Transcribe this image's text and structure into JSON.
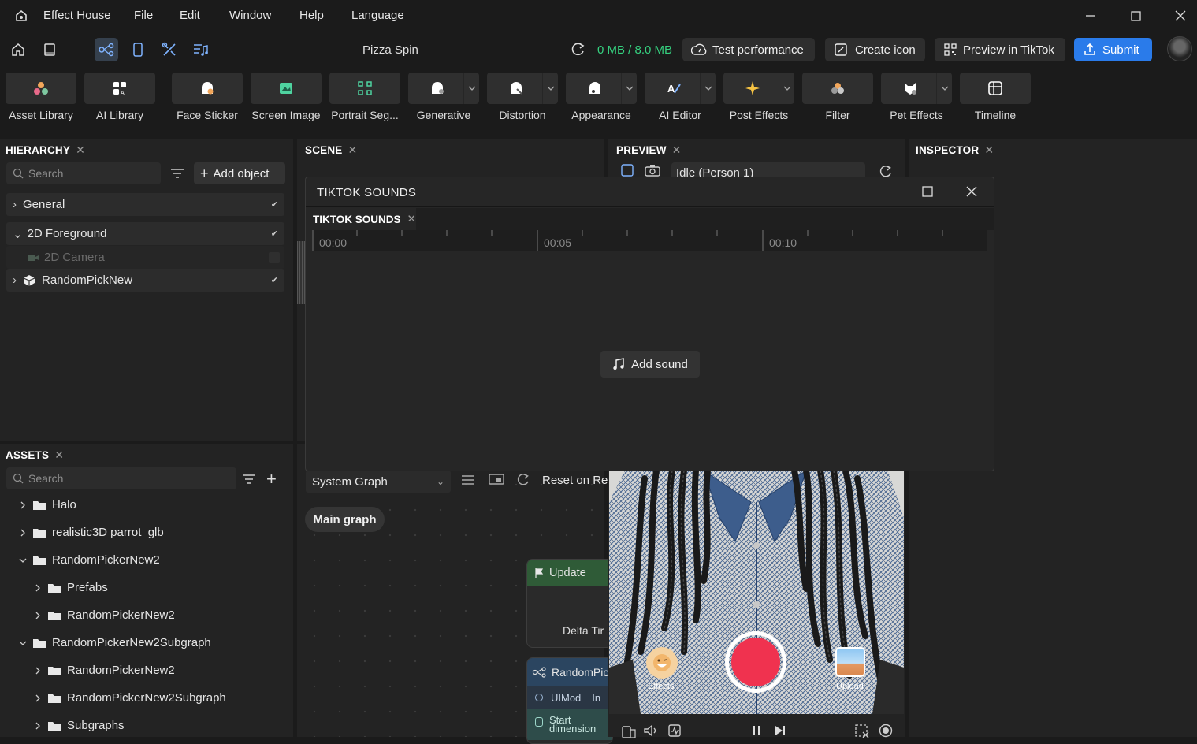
{
  "app": {
    "title": "Effect House",
    "menu": [
      "File",
      "Edit",
      "Window",
      "Help",
      "Language"
    ],
    "project_name": "Pizza Spin",
    "storage": "0 MB / 8.0 MB",
    "accent": "#2a7bea",
    "storage_color": "#35d07f"
  },
  "toolbar": {
    "test_performance": "Test performance",
    "create_icon": "Create icon",
    "preview_tiktok": "Preview in TikTok",
    "submit": "Submit"
  },
  "tools": [
    {
      "label": "Asset Library",
      "icon": "asset-library-icon"
    },
    {
      "label": "AI Library",
      "icon": "ai-library-icon"
    },
    {
      "label": "Face Sticker",
      "icon": "face-sticker-icon"
    },
    {
      "label": "Screen Image",
      "icon": "screen-image-icon"
    },
    {
      "label": "Portrait Seg...",
      "icon": "portrait-seg-icon"
    },
    {
      "label": "Generative",
      "icon": "generative-icon"
    },
    {
      "label": "Distortion",
      "icon": "distortion-icon"
    },
    {
      "label": "Appearance",
      "icon": "appearance-icon"
    },
    {
      "label": "AI Editor",
      "icon": "ai-editor-icon"
    },
    {
      "label": "Post Effects",
      "icon": "post-effects-icon"
    },
    {
      "label": "Filter",
      "icon": "filter-icon"
    },
    {
      "label": "Pet Effects",
      "icon": "pet-effects-icon"
    },
    {
      "label": "Timeline",
      "icon": "timeline-icon"
    }
  ],
  "hierarchy": {
    "tab": "HIERARCHY",
    "search_placeholder": "Search",
    "add_object": "Add object",
    "rows": [
      "General",
      "2D Foreground",
      "2D Camera",
      "RandomPickNew"
    ]
  },
  "assets": {
    "tab": "ASSETS",
    "search_placeholder": "Search",
    "items": [
      "Halo",
      "realistic3D parrot_glb",
      "RandomPickerNew2",
      "Prefabs",
      "RandomPickerNew2",
      "RandomPickerNew2Subgraph",
      "RandomPickerNew2",
      "RandomPickerNew2Subgraph",
      "Subgraphs"
    ]
  },
  "scene": {
    "tab": "SCENE"
  },
  "preview": {
    "tab": "PREVIEW",
    "person_select": "Idle (Person 1)",
    "effects": "Effects",
    "upload": "Upload"
  },
  "inspector": {
    "tab": "INSPECTOR"
  },
  "graph": {
    "system_graph": "System Graph",
    "reset": "Reset on Re",
    "main_graph": "Main graph",
    "node_update": "Update",
    "node_update_port": "Delta Tir",
    "node_random": "RandomPic",
    "node_random_port1": "UIMod",
    "node_random_port1b": "In",
    "node_random_port2": "Start",
    "node_random_port3": "dimension"
  },
  "sounds": {
    "title": "TIKTOK SOUNDS",
    "tab": "TIKTOK SOUNDS",
    "ticks": [
      "00:00",
      "00:05",
      "00:10"
    ],
    "add_sound": "Add sound"
  }
}
